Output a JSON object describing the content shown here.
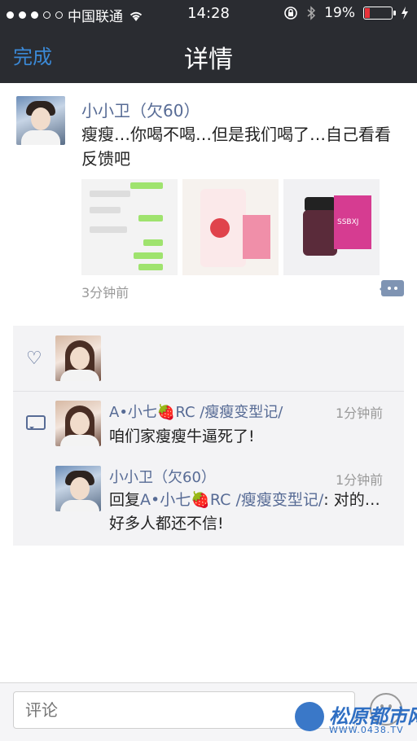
{
  "status_bar": {
    "carrier": "中国联通",
    "time": "14:28",
    "battery_percent_text": "19%",
    "battery_level": 0.19,
    "battery_color": "#e8323a",
    "icons": [
      "signal-dots",
      "wifi-icon",
      "rotation-lock-icon",
      "bluetooth-icon",
      "battery-icon",
      "charging-bolt-icon"
    ]
  },
  "nav": {
    "done_label": "完成",
    "title": "详情"
  },
  "post": {
    "author": "小小卫（欠60）",
    "content": "瘦瘦…你喝不喝…但是我们喝了…自己看看反馈吧",
    "images": [
      "chat-screenshot",
      "product-bag-photo",
      "product-bottle-photo"
    ],
    "product_label": "SSBXJ",
    "time": "3分钟前"
  },
  "interactions": {
    "likes": [
      "avatar-girl"
    ],
    "comments": [
      {
        "name": "A•小七🍓RC /瘦瘦变型记/",
        "time": "1分钟前",
        "text": "咱们家瘦瘦牛逼死了!"
      },
      {
        "name": "小小卫（欠60）",
        "time": "1分钟前",
        "reply_prefix": "回复",
        "reply_to": "A•小七🍓RC /瘦瘦变型记/",
        "text": ": 对的…好多人都还不信!"
      }
    ]
  },
  "input": {
    "placeholder": "评论"
  },
  "watermark": {
    "text": "松原都市网",
    "url": "WWW.0438.TV"
  },
  "colors": {
    "link_blue": "#576b95",
    "nav_bg": "#2a2c31",
    "accent_blue": "#3b89d6"
  }
}
